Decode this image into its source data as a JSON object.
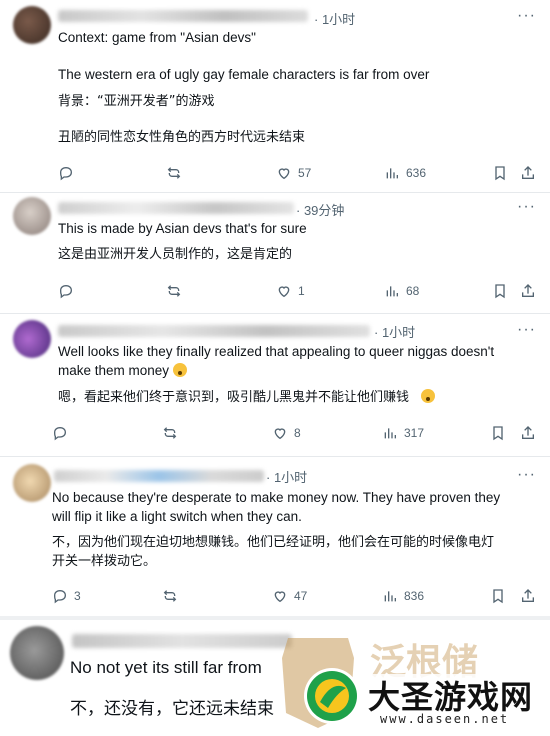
{
  "posts": [
    {
      "time": "· 1小时",
      "lines": [
        "Context: game from \"Asian devs\"",
        "The western era of ugly gay female characters is far from over",
        "背景：“亚洲开发者”的游戏",
        "丑陋的同性恋女性角色的西方时代远未结束"
      ],
      "likes": "57",
      "views": "636"
    },
    {
      "time": "· 39分钟",
      "lines": [
        "This is made by Asian devs that's for sure",
        "这是由亚洲开发人员制作的，这是肯定的"
      ],
      "likes": "1",
      "views": "68"
    },
    {
      "time": "· 1小时",
      "lines": [
        "Well looks like they finally realized that appealing to queer niggas doesn't",
        "make them money",
        "嗯，看起来他们终于意识到，吸引酷儿黑鬼并不能让他们赚钱"
      ],
      "likes": "8",
      "views": "317"
    },
    {
      "time": "· 1小时",
      "lines": [
        "No because they're desperate to make money now. They have proven they",
        "will flip it like a light switch when they can.",
        "不，因为他们现在迫切地想赚钱。他们已经证明，他们会在可能的时候像电灯",
        "开关一样拨动它。"
      ],
      "replies": "3",
      "likes": "47",
      "views": "836"
    },
    {
      "lines": [
        "No not yet its still far from",
        "不，还没有，它还远未结束"
      ]
    }
  ],
  "watermark": {
    "brand": "大圣游戏网",
    "url": "www.daseen.net"
  }
}
